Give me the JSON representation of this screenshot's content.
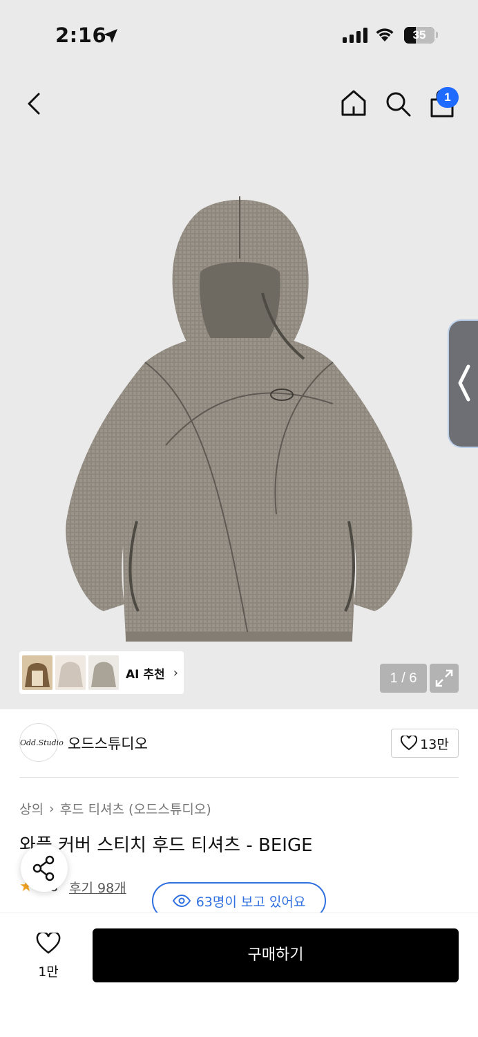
{
  "status_bar": {
    "time": "2:16",
    "battery": "35"
  },
  "header": {
    "back_icon": "chevron-left-icon",
    "home_icon": "home-icon",
    "search_icon": "search-icon",
    "bag_icon": "shopping-bag-icon",
    "cart_count": "1"
  },
  "gallery": {
    "ai_label": "AI 추천",
    "counter": "1 / 6"
  },
  "brand": {
    "logo_text": "Odd.Studio",
    "name": "오드스튜디오",
    "likes": "13만"
  },
  "breadcrumb": {
    "category": "상의",
    "subcategory": "후드 티셔츠 (오드스튜디오)"
  },
  "product": {
    "title": "와플 커버 스티치 후드 티셔츠 - BEIGE",
    "rating": "4.8",
    "reviews": "후기 98개",
    "viewers": "63명이 보고 있어요"
  },
  "bottom": {
    "wish_count": "1만",
    "buy_label": "구매하기"
  },
  "colors": {
    "accent_blue": "#2f6fe0",
    "badge_blue": "#1f6bff",
    "star": "#f5a623",
    "hoodie": "#8e877d"
  }
}
